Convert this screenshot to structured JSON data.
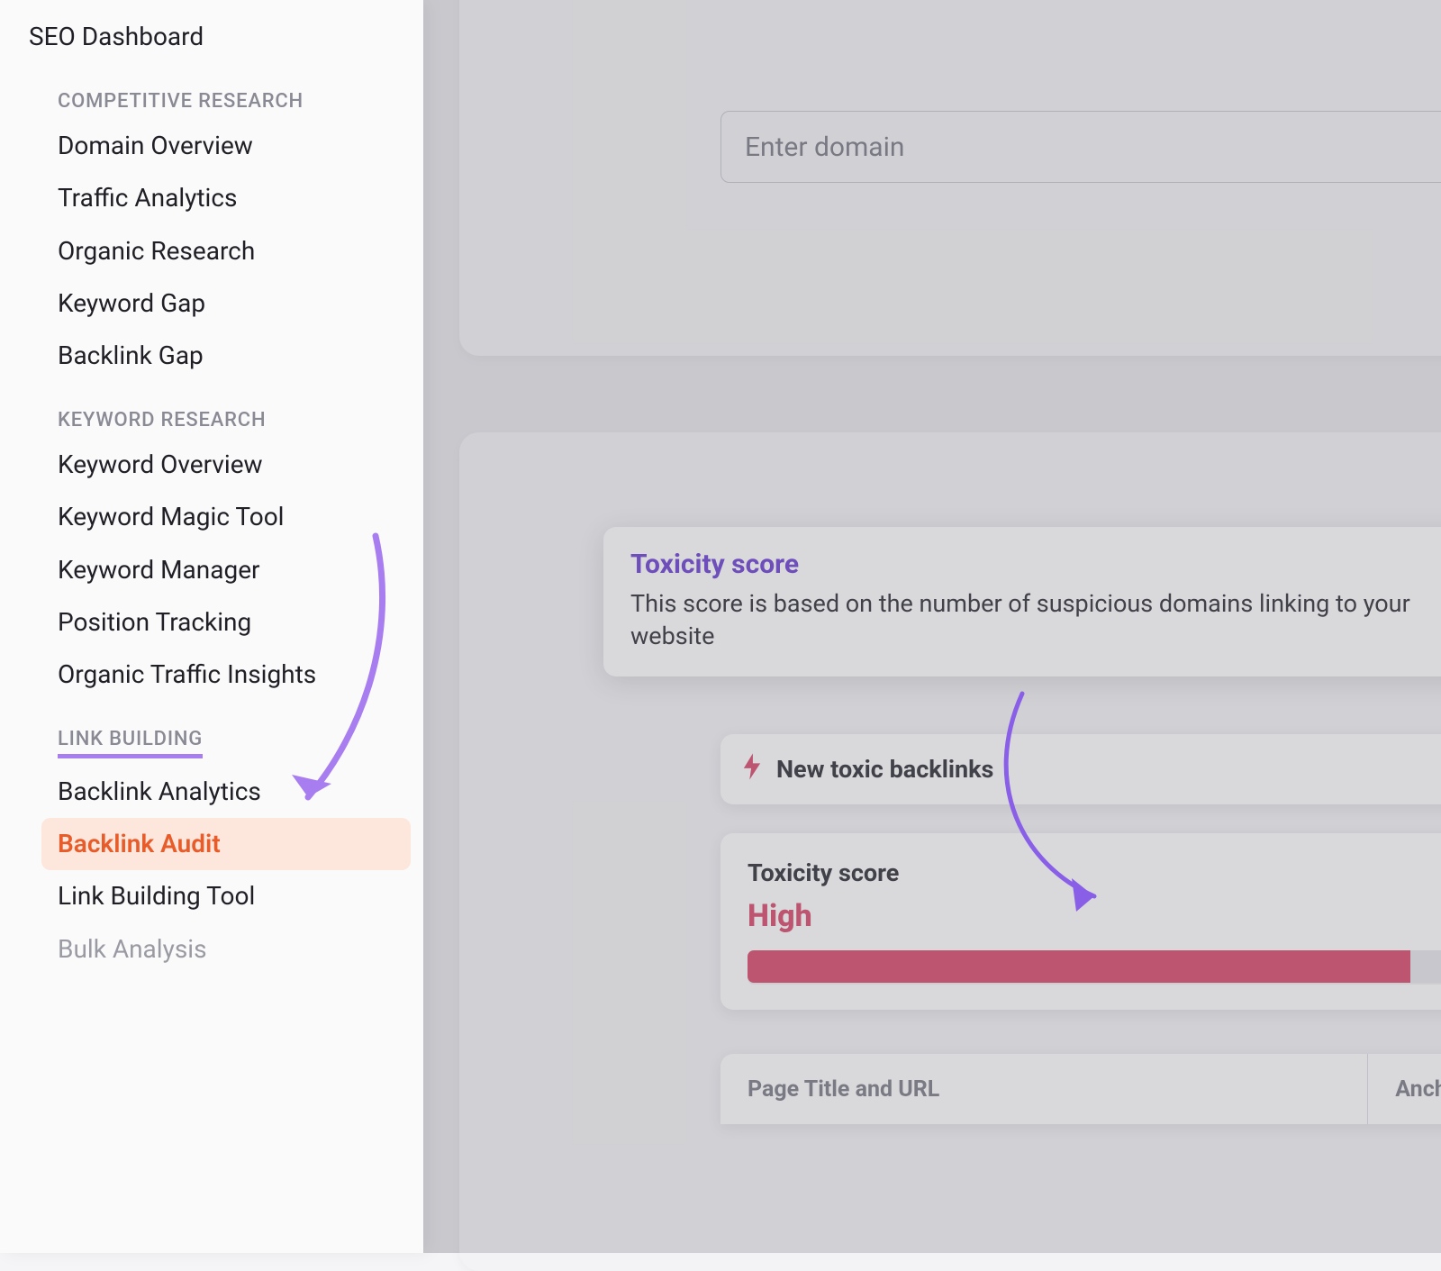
{
  "sidebar": {
    "top_item": "SEO Dashboard",
    "sections": [
      {
        "heading": "COMPETITIVE RESEARCH",
        "items": [
          "Domain Overview",
          "Traffic Analytics",
          "Organic Research",
          "Keyword Gap",
          "Backlink Gap"
        ]
      },
      {
        "heading": "KEYWORD RESEARCH",
        "items": [
          "Keyword Overview",
          "Keyword Magic Tool",
          "Keyword Manager",
          "Position Tracking",
          "Organic Traffic Insights"
        ]
      },
      {
        "heading": "LINK BUILDING",
        "items": [
          "Backlink Analytics",
          "Backlink Audit",
          "Link Building Tool",
          "Bulk Analysis"
        ]
      }
    ],
    "active_item": "Backlink Audit",
    "highlighted_section": "LINK BUILDING"
  },
  "main": {
    "domain_placeholder": "Enter domain",
    "tooltip": {
      "title": "Toxicity score",
      "desc": "This score is based on the number of suspicious domains linking to your website"
    },
    "toxic_pill": "New toxic backlinks",
    "score": {
      "label": "Toxicity score",
      "value": "High"
    },
    "table": {
      "col1": "Page Title and URL",
      "col2": "Anchor"
    }
  },
  "colors": {
    "accent_purple": "#a87df0",
    "accent_orange": "#e85c2a",
    "danger": "#d9486b"
  }
}
